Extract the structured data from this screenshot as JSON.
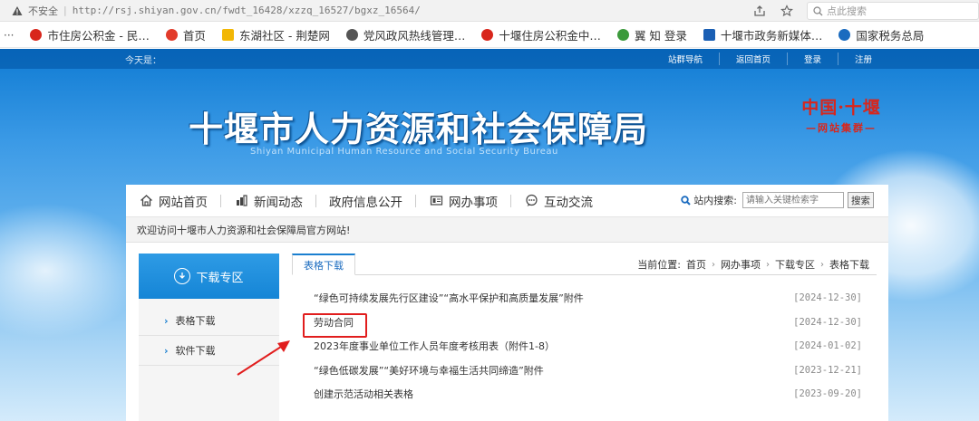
{
  "browser": {
    "insecure_label": "不安全",
    "url": "http://rsj.shiyan.gov.cn/fwdt_16428/xzzq_16527/bgxz_16564/",
    "search_placeholder": "点此搜索"
  },
  "bookmarks": [
    {
      "label": "市住房公积金 - 民…",
      "color": "#d8261c"
    },
    {
      "label": "首页",
      "color": "#e23b2b"
    },
    {
      "label": "东湖社区 - 荆楚网",
      "color": "#f2b705"
    },
    {
      "label": "党风政风热线管理…",
      "color": "#555555"
    },
    {
      "label": "十堰住房公积金中…",
      "color": "#d8261c"
    },
    {
      "label": "翼 知 登录",
      "color": "#3c9a3c"
    },
    {
      "label": "十堰市政务新媒体…",
      "color": "#1a5fb4"
    },
    {
      "label": "国家税务总局",
      "color": "#1a6bbf"
    }
  ],
  "topbar": {
    "today_label": "今天是：",
    "links": [
      "站群导航",
      "返回首页",
      "登录",
      "注册"
    ]
  },
  "header": {
    "title": "十堰市人力资源和社会保障局",
    "subtitle": "Shiyan Municipal Human Resource and Social Security Bureau",
    "group_logo_main": "中国·十堰",
    "group_logo_sub": "—网站集群—"
  },
  "nav": {
    "items": [
      {
        "label": "网站首页",
        "icon": "home-icon"
      },
      {
        "label": "新闻动态",
        "icon": "news-icon"
      },
      {
        "label": "政府信息公开",
        "icon": "doc-icon"
      },
      {
        "label": "网办事项",
        "icon": "service-icon"
      },
      {
        "label": "互动交流",
        "icon": "chat-icon"
      }
    ],
    "search_label": "站内搜索:",
    "search_placeholder": "请输入关键检索字",
    "search_button": "搜索"
  },
  "welcome": "欢迎访问十堰市人力资源和社会保障局官方网站!",
  "sidebar": {
    "title": "下载专区",
    "items": [
      "表格下载",
      "软件下载"
    ]
  },
  "content": {
    "tab": "表格下载",
    "breadcrumb": {
      "label": "当前位置:",
      "items": [
        "首页",
        "网办事项",
        "下载专区",
        "表格下载"
      ]
    },
    "rows": [
      {
        "title": "“绿色可持续发展先行区建设”“高水平保护和高质量发展”附件",
        "date": "[2024-12-30]"
      },
      {
        "title": "劳动合同",
        "date": "[2024-12-30]"
      },
      {
        "title": "2023年度事业单位工作人员年度考核用表（附件1-8）",
        "date": "[2024-01-02]"
      },
      {
        "title": "“绿色低碳发展”“美好环境与幸福生活共同缔造”附件",
        "date": "[2023-12-21]"
      },
      {
        "title": "创建示范活动相关表格",
        "date": "[2023-09-20]"
      }
    ]
  },
  "colors": {
    "accent_blue": "#1a7fd0",
    "highlight_red": "#e11d1d"
  }
}
